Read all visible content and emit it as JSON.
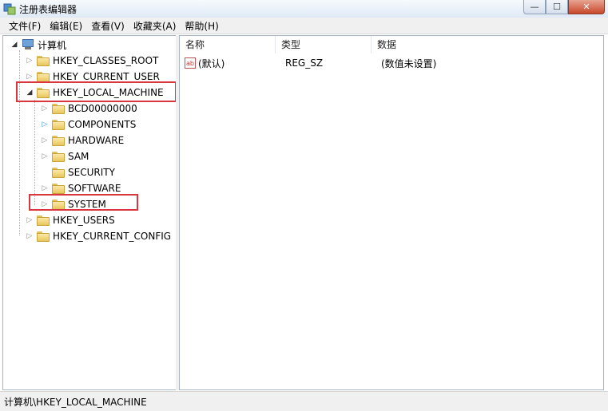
{
  "window": {
    "title": "注册表编辑器",
    "min_glyph": "—",
    "max_glyph": "☐",
    "close_glyph": "✕"
  },
  "menu": {
    "items": [
      "文件(F)",
      "编辑(E)",
      "查看(V)",
      "收藏夹(A)",
      "帮助(H)"
    ]
  },
  "tree": {
    "root": "计算机",
    "hives": {
      "classes_root": "HKEY_CLASSES_ROOT",
      "current_user": "HKEY_CURRENT_USER",
      "local_machine": "HKEY_LOCAL_MACHINE",
      "users": "HKEY_USERS",
      "current_config": "HKEY_CURRENT_CONFIG"
    },
    "local_machine_children": [
      "BCD00000000",
      "COMPONENTS",
      "HARDWARE",
      "SAM",
      "SECURITY",
      "SOFTWARE",
      "SYSTEM"
    ]
  },
  "list": {
    "columns": [
      "名称",
      "类型",
      "数据"
    ],
    "rows": [
      {
        "name": "(默认)",
        "type": "REG_SZ",
        "data": "(数值未设置)",
        "icon": "ab"
      }
    ]
  },
  "status": {
    "path": "计算机\\HKEY_LOCAL_MACHINE"
  },
  "colors": {
    "highlight_box": "#d9363e"
  }
}
